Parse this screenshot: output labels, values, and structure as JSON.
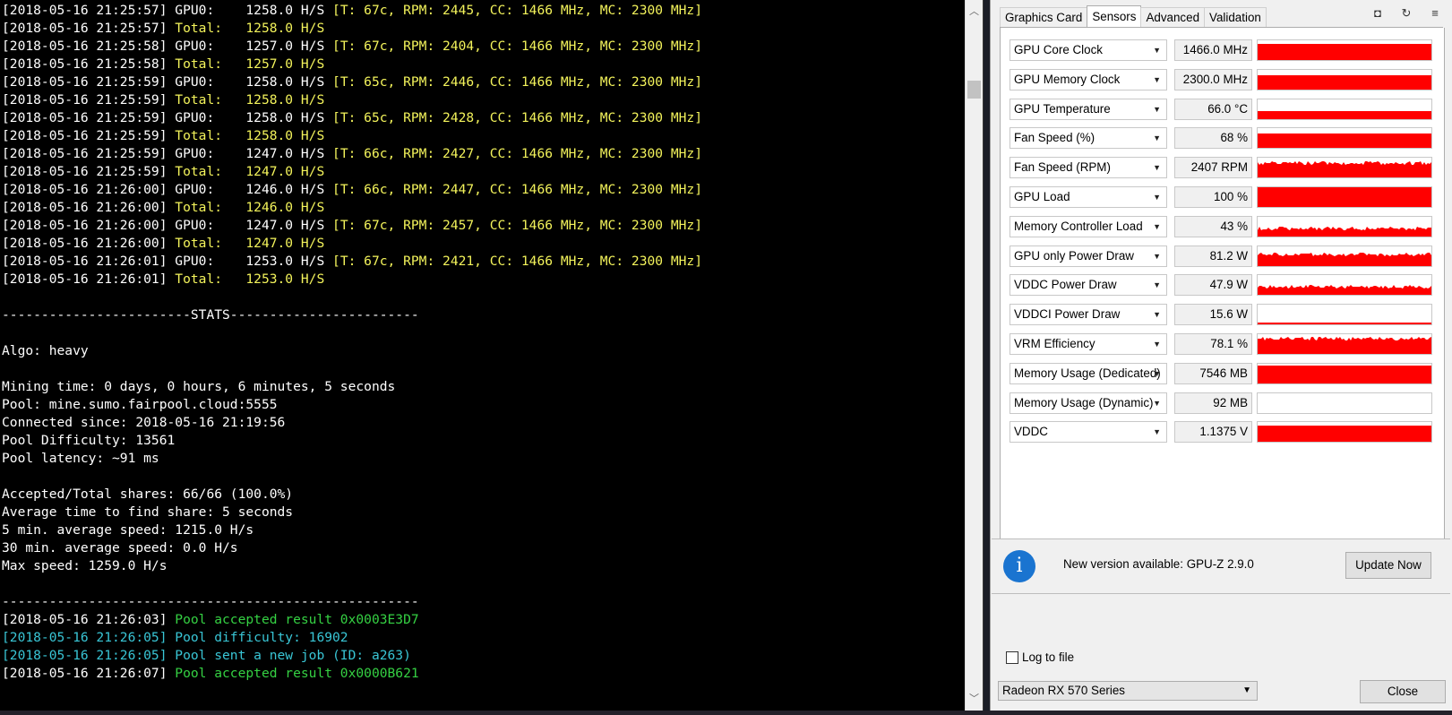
{
  "console": {
    "lines": [
      [
        {
          "t": "[2018-05-16 21:25:57] GPU0:    1258.0 H/S ",
          "c": "white"
        },
        {
          "t": "[T: 67c, RPM: 2445, CC: 1466 MHz, MC: 2300 MHz]",
          "c": "yellow"
        }
      ],
      [
        {
          "t": "[2018-05-16 21:25:57] ",
          "c": "white"
        },
        {
          "t": "Total:   1258.0 H/S",
          "c": "yellow"
        }
      ],
      [
        {
          "t": "[2018-05-16 21:25:58] GPU0:    1257.0 H/S ",
          "c": "white"
        },
        {
          "t": "[T: 67c, RPM: 2404, CC: 1466 MHz, MC: 2300 MHz]",
          "c": "yellow"
        }
      ],
      [
        {
          "t": "[2018-05-16 21:25:58] ",
          "c": "white"
        },
        {
          "t": "Total:   1257.0 H/S",
          "c": "yellow"
        }
      ],
      [
        {
          "t": "[2018-05-16 21:25:59] GPU0:    1258.0 H/S ",
          "c": "white"
        },
        {
          "t": "[T: 65c, RPM: 2446, CC: 1466 MHz, MC: 2300 MHz]",
          "c": "yellow"
        }
      ],
      [
        {
          "t": "[2018-05-16 21:25:59] ",
          "c": "white"
        },
        {
          "t": "Total:   1258.0 H/S",
          "c": "yellow"
        }
      ],
      [
        {
          "t": "[2018-05-16 21:25:59] GPU0:    1258.0 H/S ",
          "c": "white"
        },
        {
          "t": "[T: 65c, RPM: 2428, CC: 1466 MHz, MC: 2300 MHz]",
          "c": "yellow"
        }
      ],
      [
        {
          "t": "[2018-05-16 21:25:59] ",
          "c": "white"
        },
        {
          "t": "Total:   1258.0 H/S",
          "c": "yellow"
        }
      ],
      [
        {
          "t": "[2018-05-16 21:25:59] GPU0:    1247.0 H/S ",
          "c": "white"
        },
        {
          "t": "[T: 66c, RPM: 2427, CC: 1466 MHz, MC: 2300 MHz]",
          "c": "yellow"
        }
      ],
      [
        {
          "t": "[2018-05-16 21:25:59] ",
          "c": "white"
        },
        {
          "t": "Total:   1247.0 H/S",
          "c": "yellow"
        }
      ],
      [
        {
          "t": "[2018-05-16 21:26:00] GPU0:    1246.0 H/S ",
          "c": "white"
        },
        {
          "t": "[T: 66c, RPM: 2447, CC: 1466 MHz, MC: 2300 MHz]",
          "c": "yellow"
        }
      ],
      [
        {
          "t": "[2018-05-16 21:26:00] ",
          "c": "white"
        },
        {
          "t": "Total:   1246.0 H/S",
          "c": "yellow"
        }
      ],
      [
        {
          "t": "[2018-05-16 21:26:00] GPU0:    1247.0 H/S ",
          "c": "white"
        },
        {
          "t": "[T: 67c, RPM: 2457, CC: 1466 MHz, MC: 2300 MHz]",
          "c": "yellow"
        }
      ],
      [
        {
          "t": "[2018-05-16 21:26:00] ",
          "c": "white"
        },
        {
          "t": "Total:   1247.0 H/S",
          "c": "yellow"
        }
      ],
      [
        {
          "t": "[2018-05-16 21:26:01] GPU0:    1253.0 H/S ",
          "c": "white"
        },
        {
          "t": "[T: 67c, RPM: 2421, CC: 1466 MHz, MC: 2300 MHz]",
          "c": "yellow"
        }
      ],
      [
        {
          "t": "[2018-05-16 21:26:01] ",
          "c": "white"
        },
        {
          "t": "Total:   1253.0 H/S",
          "c": "yellow"
        }
      ],
      [],
      [
        {
          "t": "------------------------STATS------------------------",
          "c": "white"
        }
      ],
      [],
      [
        {
          "t": "Algo: heavy",
          "c": "white"
        }
      ],
      [],
      [
        {
          "t": "Mining time: 0 days, 0 hours, 6 minutes, 5 seconds",
          "c": "white"
        }
      ],
      [
        {
          "t": "Pool: mine.sumo.fairpool.cloud:5555",
          "c": "white"
        }
      ],
      [
        {
          "t": "Connected since: 2018-05-16 21:19:56",
          "c": "white"
        }
      ],
      [
        {
          "t": "Pool Difficulty: 13561",
          "c": "white"
        }
      ],
      [
        {
          "t": "Pool latency: ~91 ms",
          "c": "white"
        }
      ],
      [],
      [
        {
          "t": "Accepted/Total shares: 66/66 (100.0%)",
          "c": "white"
        }
      ],
      [
        {
          "t": "Average time to find share: 5 seconds",
          "c": "white"
        }
      ],
      [
        {
          "t": "5 min. average speed: 1215.0 H/s",
          "c": "white"
        }
      ],
      [
        {
          "t": "30 min. average speed: 0.0 H/s",
          "c": "white"
        }
      ],
      [
        {
          "t": "Max speed: 1259.0 H/s",
          "c": "white"
        }
      ],
      [],
      [
        {
          "t": "-----------------------------------------------------",
          "c": "white"
        }
      ],
      [
        {
          "t": "[2018-05-16 21:26:03] ",
          "c": "white"
        },
        {
          "t": "Pool accepted result 0x0003E3D7",
          "c": "green"
        }
      ],
      [
        {
          "t": "[2018-05-16 21:26:05] Pool difficulty: 16902",
          "c": "cyan"
        }
      ],
      [
        {
          "t": "[2018-05-16 21:26:05] Pool sent a new job (ID: a263)",
          "c": "cyan"
        }
      ],
      [
        {
          "t": "[2018-05-16 21:26:07] ",
          "c": "white"
        },
        {
          "t": "Pool accepted result 0x0000B621",
          "c": "green"
        }
      ]
    ],
    "colors": {
      "white": "#ffffff",
      "yellow": "#f3f35b",
      "green": "#35d143",
      "cyan": "#39c6d6"
    }
  },
  "gpuz": {
    "tabs": [
      "Graphics Card",
      "Sensors",
      "Advanced",
      "Validation"
    ],
    "active_tab": "Sensors",
    "sensors": [
      {
        "name": "GPU Core Clock",
        "value": "1466.0 MHz",
        "level": 0.82,
        "noisy": false
      },
      {
        "name": "GPU Memory Clock",
        "value": "2300.0 MHz",
        "level": 0.72,
        "noisy": false
      },
      {
        "name": "GPU Temperature",
        "value": "66.0 °C",
        "level": 0.42,
        "noisy": false
      },
      {
        "name": "Fan Speed (%)",
        "value": "68 %",
        "level": 0.72,
        "noisy": false
      },
      {
        "name": "Fan Speed (RPM)",
        "value": "2407 RPM",
        "level": 0.72,
        "noisy": true
      },
      {
        "name": "GPU Load",
        "value": "100 %",
        "level": 1.0,
        "noisy": false
      },
      {
        "name": "Memory Controller Load",
        "value": "43 %",
        "level": 0.43,
        "noisy": true
      },
      {
        "name": "GPU only Power Draw",
        "value": "81.2 W",
        "level": 0.6,
        "noisy": true
      },
      {
        "name": "VDDC Power Draw",
        "value": "47.9 W",
        "level": 0.4,
        "noisy": true
      },
      {
        "name": "VDDCI Power Draw",
        "value": "15.6 W",
        "level": 0.08,
        "noisy": false
      },
      {
        "name": "VRM Efficiency",
        "value": "78.1 %",
        "level": 0.78,
        "noisy": true
      },
      {
        "name": "Memory Usage (Dedicated)",
        "value": "7546 MB",
        "level": 0.92,
        "noisy": false
      },
      {
        "name": "Memory Usage (Dynamic)",
        "value": "92 MB",
        "level": 0.0,
        "noisy": false
      },
      {
        "name": "VDDC",
        "value": "1.1375 V",
        "level": 0.82,
        "noisy": false
      }
    ],
    "graph_color": "#ff0000",
    "notice": {
      "text": "New version available: GPU-Z 2.9.0",
      "button": "Update Now",
      "icon": "info-icon"
    },
    "log_to_file": {
      "label": "Log to file",
      "checked": false
    },
    "gpu_select": "Radeon RX 570 Series",
    "close_label": "Close",
    "toolbar_icons": [
      "camera-icon",
      "refresh-icon",
      "menu-icon"
    ]
  }
}
